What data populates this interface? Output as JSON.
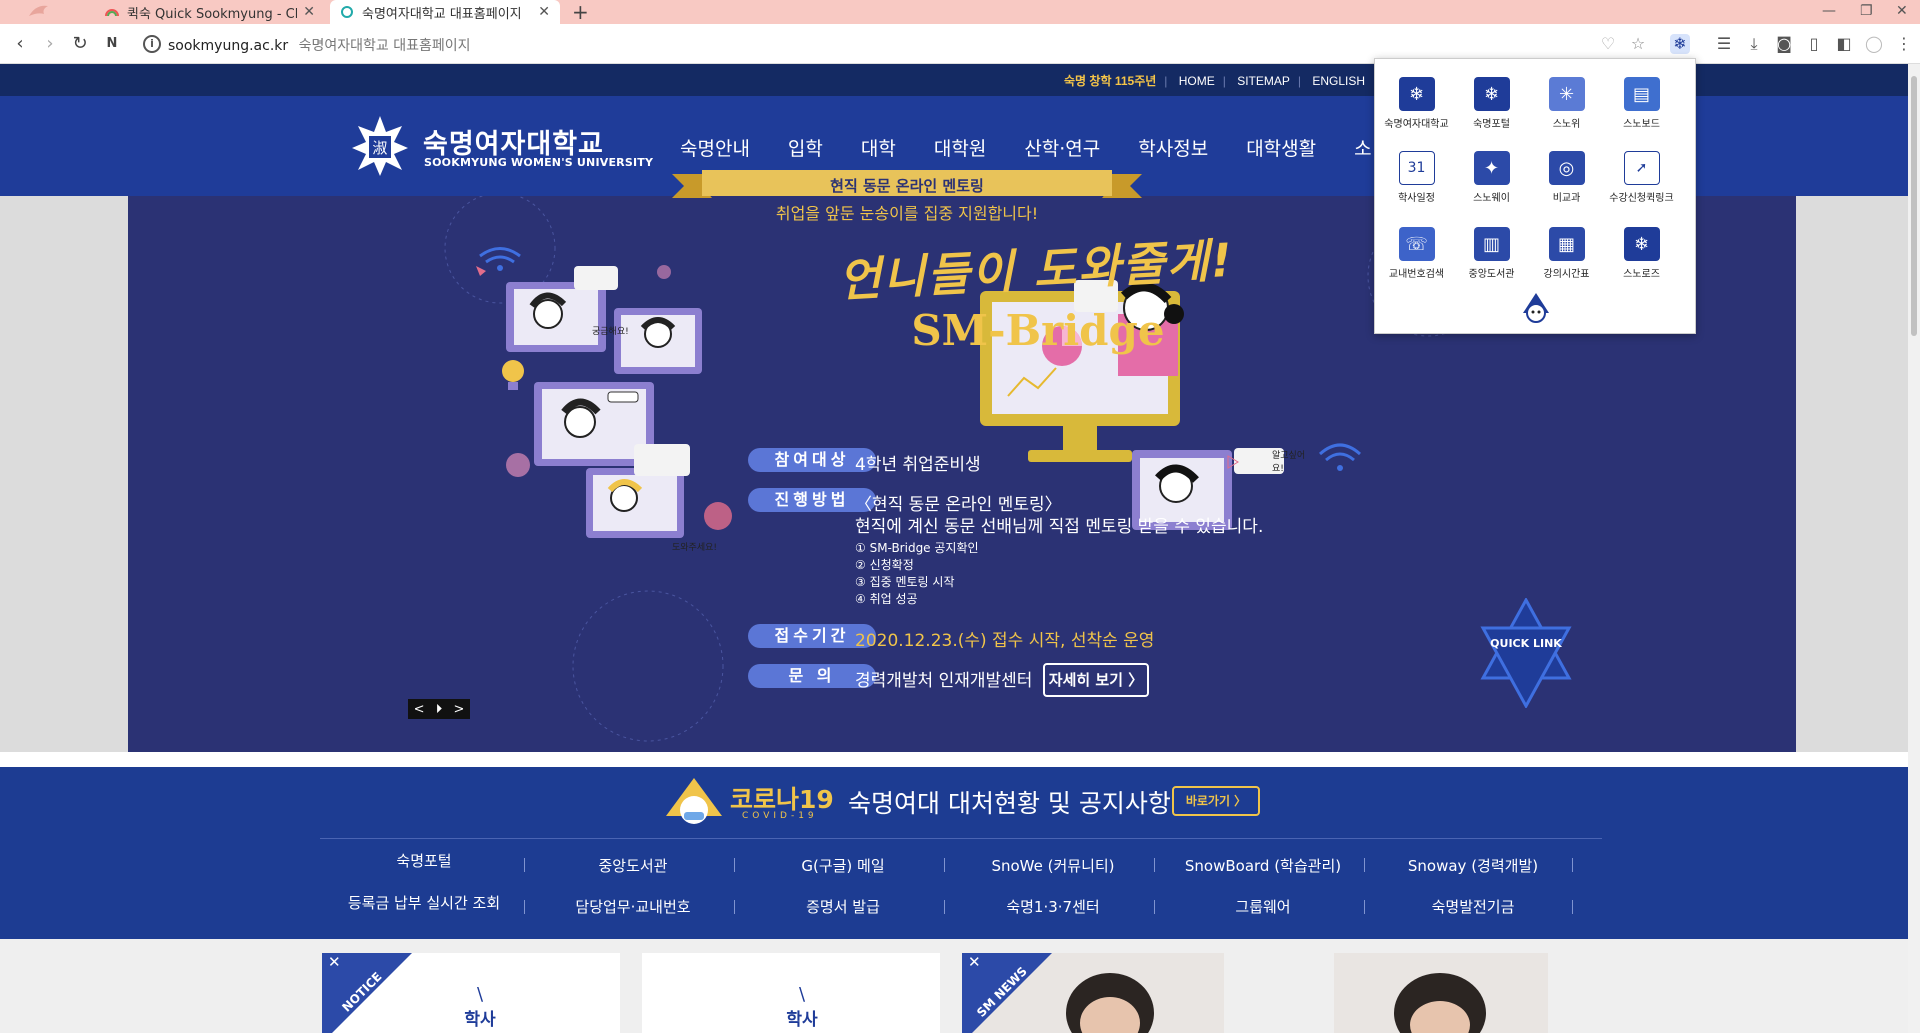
{
  "browser": {
    "tabs": [
      {
        "title": "퀵숙 Quick Sookmyung - Chrom"
      },
      {
        "title": "숙명여자대학교 대표홈페이지"
      }
    ],
    "new_tab": "+",
    "url": "sookmyung.ac.kr",
    "page_title": "숙명여자대학교 대표홈페이지"
  },
  "site": {
    "toplinks": {
      "anniversary": "숙명 창학 115주년",
      "home": "HOME",
      "sitemap": "SITEMAP",
      "english": "ENGLISH"
    },
    "logo": {
      "ko": "숙명여자대학교",
      "en": "SOOKMYUNG WOMEN'S UNIVERSITY",
      "seal": "淑"
    },
    "menu": [
      "숙명안내",
      "입학",
      "대학",
      "대학원",
      "산학·연구",
      "학사정보",
      "대학생활",
      "소"
    ]
  },
  "hero": {
    "headline": "언니들이 도와줄게!",
    "title": "SM-Bridge",
    "ribbon": "현직 동문 온라인 멘토링",
    "subtitle": "취업을 앞둔 눈송이를 집중 지원합니다!",
    "rows": [
      {
        "label": "참여대상",
        "value": "4학년 취업준비생"
      },
      {
        "label": "진행방법",
        "value": "〈현직 동문 온라인 멘토링〉",
        "value2": "현직에 계신 동문 선배님께 직접 멘토링 받을 수 있습니다."
      },
      {
        "label": "접수기간",
        "value": "2020.12.23.(수) 접수 시작, 선착순 운영"
      },
      {
        "label": "문 의",
        "value": "경력개발처 인재개발센터"
      }
    ],
    "steps": [
      "① SM-Bridge 공지확인",
      "② 신청확정",
      "③ 집중 멘토링 시작",
      "④ 취업 성공"
    ],
    "detail_button": "자세히 보기 〉",
    "bubbles": [
      "궁금해요!",
      "도와주세요!",
      "언니들이 도와줄게!",
      "알고싶어요!"
    ],
    "slider": {
      "prev": "<",
      "pause": "⏵",
      "next": ">"
    },
    "quicklink": "QUICK LINK"
  },
  "covid": {
    "title": "코로나19",
    "sub": "COVID-19",
    "heading": "숙명여대 대처현황 및 공지사항",
    "go": "바로가기 〉",
    "links_row1": [
      "숙명포털",
      "중앙도서관",
      "G(구글) 메일",
      "SnoWe (커뮤니티)",
      "SnowBoard (학습관리)",
      "Snoway (경력개발)"
    ],
    "links_row2": [
      "등록금 납부 실시간 조회",
      "담당업무·교내번호",
      "증명서 발급",
      "숙명1·3·7센터",
      "그룹웨어",
      "숙명발전기금"
    ]
  },
  "cards": [
    {
      "badge": "NOTICE",
      "title": "학사",
      "mark": "\\"
    },
    {
      "title": "학사",
      "mark": "\\"
    },
    {
      "badge": "SM NEWS"
    }
  ],
  "popup": {
    "items": [
      {
        "label": "숙명여자대학교",
        "icon": "snowflake-crest-icon",
        "color": "#1f3c99",
        "glyph": "❄"
      },
      {
        "label": "숙명포털",
        "icon": "snowflake-crest-icon",
        "color": "#1f3c99",
        "glyph": "❄"
      },
      {
        "label": "스노위",
        "icon": "snowflake-icon",
        "color": "#5b7bd5",
        "glyph": "✳"
      },
      {
        "label": "스노보드",
        "icon": "board-icon",
        "color": "#3f6fcf",
        "glyph": "▤"
      },
      {
        "label": "학사일정",
        "icon": "calendar-icon",
        "color": "#ffffff",
        "glyph": "31"
      },
      {
        "label": "스노웨이",
        "icon": "snoway-icon",
        "color": "#2c4aa8",
        "glyph": "✦"
      },
      {
        "label": "비교과",
        "icon": "target-icon",
        "color": "#2c4aa8",
        "glyph": "◎"
      },
      {
        "label": "수강신청퀵링크",
        "icon": "cursor-icon",
        "color": "#ffffff",
        "glyph": "➚"
      },
      {
        "label": "교내번호검색",
        "icon": "phone-icon",
        "color": "#3d63c9",
        "glyph": "☏"
      },
      {
        "label": "중앙도서관",
        "icon": "books-icon",
        "color": "#2c4aa8",
        "glyph": "▥"
      },
      {
        "label": "강의시간표",
        "icon": "timetable-icon",
        "color": "#2c4aa8",
        "glyph": "▦"
      },
      {
        "label": "스노로즈",
        "icon": "snowflake-icon",
        "color": "#1f3c99",
        "glyph": "❄"
      }
    ]
  }
}
